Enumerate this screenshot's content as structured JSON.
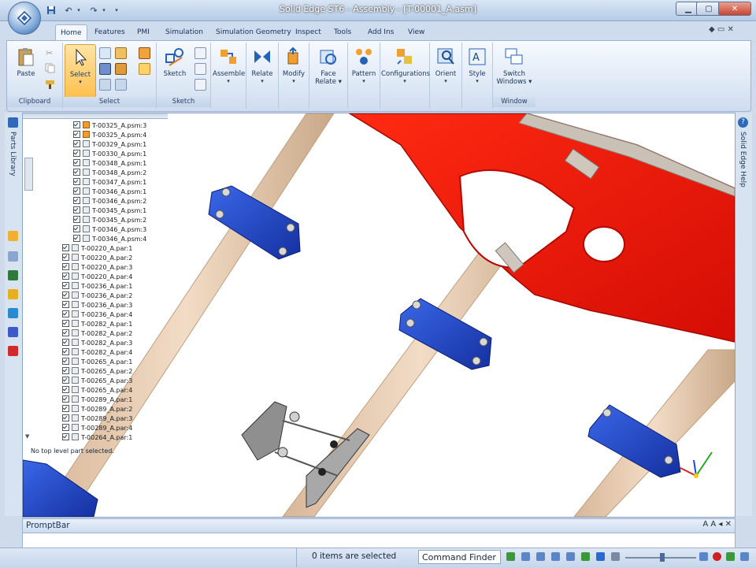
{
  "title": "Solid Edge ST6 - Assembly - [T-00001_A.asm]",
  "tabs": [
    "Home",
    "Features",
    "PMI",
    "Simulation",
    "Simulation Geometry",
    "Inspect",
    "Tools",
    "Add Ins",
    "View"
  ],
  "active_tab": "Home",
  "ribbon": {
    "clipboard": {
      "label": "Clipboard",
      "paste": "Paste"
    },
    "select": {
      "label": "Select",
      "button": "Select"
    },
    "sketch": {
      "label": "Sketch",
      "button": "Sketch"
    },
    "assemble": "Assemble",
    "relate": "Relate",
    "modify": "Modify",
    "face_relate": [
      "Face",
      "Relate"
    ],
    "pattern": "Pattern",
    "configurations": "Configurations",
    "orient": "Orient",
    "style": "Style",
    "window": {
      "label": "Window",
      "switch": [
        "Switch",
        "Windows"
      ]
    }
  },
  "left_panel": {
    "parts_library": "Parts Library"
  },
  "right_panel": {
    "help": "Solid Edge Help"
  },
  "pathfinder": {
    "items_psm": [
      "T-00325_A.psm:3",
      "T-00325_A.psm:4",
      "T-00329_A.psm:1",
      "T-00330_A.psm:1",
      "T-00348_A.psm:1",
      "T-00348_A.psm:2",
      "T-00347_A.psm:1",
      "T-00346_A.psm:1",
      "T-00346_A.psm:2",
      "T-00345_A.psm:1",
      "T-00345_A.psm:2",
      "T-00346_A.psm:3",
      "T-00346_A.psm:4"
    ],
    "items_par": [
      "T-00220_A.par:1",
      "T-00220_A.par:2",
      "T-00220_A.par:3",
      "T-00220_A.par:4",
      "T-00236_A.par:1",
      "T-00236_A.par:2",
      "T-00236_A.par:3",
      "T-00236_A.par:4",
      "T-00282_A.par:1",
      "T-00282_A.par:2",
      "T-00282_A.par:3",
      "T-00282_A.par:4",
      "T-00265_A.par:1",
      "T-00265_A.par:2",
      "T-00265_A.par:3",
      "T-00265_A.par:4",
      "T-00289_A.par:1",
      "T-00289_A.par:2",
      "T-00289_A.par:3",
      "T-00289_A.par:4",
      "T-00264_A.par:1"
    ],
    "status": "No top level part selected."
  },
  "promptbar": {
    "title": "PromptBar",
    "text": ""
  },
  "statusbar": {
    "selection": "0 items are selected",
    "command_finder": "Command Finder"
  },
  "colors": {
    "red_part": "#e8150a",
    "blue_part": "#1f46c8",
    "rail": "#e9ccb0",
    "ribbon": "#dbe6f4"
  }
}
